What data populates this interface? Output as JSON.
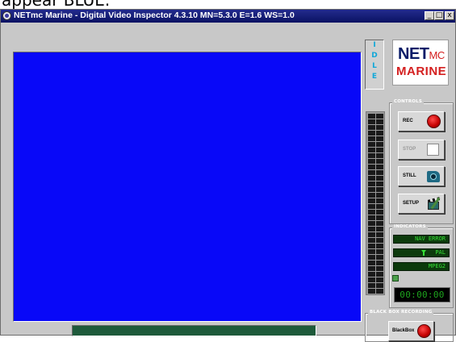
{
  "overlay_text": "appear BLUE.",
  "window": {
    "title": "NETmc Marine - Digital Video Inspector 4.3.10 MN=5.3.0 E=1.6 WS=1.0",
    "min_label": "_",
    "max_label": "□",
    "close_label": "x"
  },
  "status": {
    "letters": [
      "I",
      "D",
      "L",
      "E"
    ],
    "color": "#10a7d8"
  },
  "logo": {
    "net": "NET",
    "mc": "MC",
    "marine": "MARINE"
  },
  "video": {
    "background": "#0808f8"
  },
  "progress": {
    "fraction": 1.0,
    "color": "#1e5a3b"
  },
  "controls": {
    "label": "CONTROLS",
    "rec_label": "REC",
    "stop_label": "STOP",
    "still_label": "STILL",
    "setup_label": "SETUP"
  },
  "indicators": {
    "label": "INDICATORS",
    "nav_error": "NAV ERROR",
    "pal": "PAL",
    "mpeg": "MPEG2",
    "timecode": "00:00:00"
  },
  "blackbox": {
    "label": "BLACK BOX RECORDING",
    "button_label": "BlackBox"
  }
}
